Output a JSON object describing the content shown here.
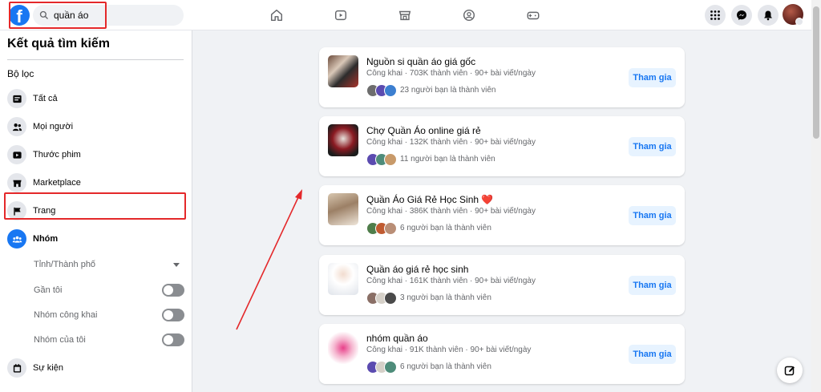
{
  "search": {
    "value": "quần áo"
  },
  "sidebar": {
    "title": "Kết quả tìm kiếm",
    "filter_heading": "Bộ lọc",
    "items": [
      {
        "label": "Tất cả",
        "icon": "posts-icon"
      },
      {
        "label": "Mọi người",
        "icon": "people-icon"
      },
      {
        "label": "Thước phim",
        "icon": "video-icon"
      },
      {
        "label": "Marketplace",
        "icon": "store-icon"
      },
      {
        "label": "Trang",
        "icon": "flag-icon"
      },
      {
        "label": "Nhóm",
        "icon": "groups-icon",
        "active": true
      },
      {
        "label": "Sự kiện",
        "icon": "calendar-icon"
      }
    ],
    "sub_filters": {
      "city_label": "Tỉnh/Thành phố",
      "near_label": "Gần tôi",
      "public_label": "Nhóm công khai",
      "mine_label": "Nhóm của tôi"
    }
  },
  "groups": [
    {
      "name": "Nguồn si quần áo giá gốc",
      "meta": "Công khai · 703K thành viên · 90+ bài viết/ngày",
      "friends": "23 người bạn là thành viên",
      "join": "Tham gia"
    },
    {
      "name": "Chợ Quần Áo online giá rẻ",
      "meta": "Công khai · 132K thành viên · 90+ bài viết/ngày",
      "friends": "11 người bạn là thành viên",
      "join": "Tham gia"
    },
    {
      "name": "Quần Áo Giá Rẻ Học Sinh",
      "meta": "Công khai · 386K thành viên · 90+ bài viết/ngày",
      "friends": "6 người bạn là thành viên",
      "join": "Tham gia",
      "emoji": "❤️"
    },
    {
      "name": "Quần áo giá rẻ học sinh",
      "meta": "Công khai · 161K thành viên · 90+ bài viết/ngày",
      "friends": "3 người bạn là thành viên",
      "join": "Tham gia"
    },
    {
      "name": "nhóm quần áo",
      "meta": "Công khai · 91K thành viên · 90+ bài viết/ngày",
      "friends": "6 người bạn là thành viên",
      "join": "Tham gia"
    }
  ],
  "colors": {
    "brand": "#1877f2",
    "highlight": "#e4282a"
  }
}
